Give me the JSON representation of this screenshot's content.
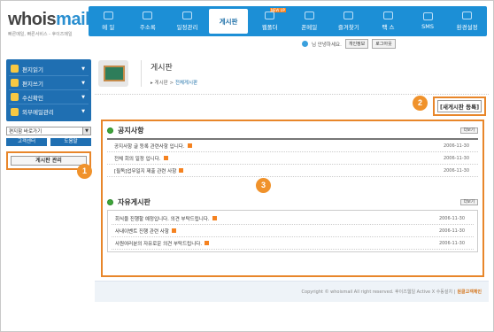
{
  "logo": {
    "brand_a": "whois",
    "brand_b": "mail",
    "tagline": "빠른메일, 빠른서비스 - 후이즈메일"
  },
  "nav": {
    "items": [
      {
        "label": "메 일",
        "icon": "mail-icon"
      },
      {
        "label": "주소록",
        "icon": "address-book-icon"
      },
      {
        "label": "일정관리",
        "icon": "calendar-icon"
      },
      {
        "label": "게시판",
        "icon": "board-icon"
      },
      {
        "label": "웹폴더",
        "icon": "folder-icon",
        "badge": "NEW UP"
      },
      {
        "label": "폰메일",
        "icon": "phone-icon"
      },
      {
        "label": "즐겨찾기",
        "icon": "bookmark-icon"
      },
      {
        "label": "팩 스",
        "icon": "fax-icon"
      },
      {
        "label": "SMS",
        "icon": "sms-icon"
      },
      {
        "label": "환경설정",
        "icon": "settings-icon"
      }
    ],
    "active_index": 3
  },
  "userbar": {
    "greeting": "님 안녕하세요.",
    "btn_profile": "개인정보",
    "btn_logout": "로그아웃"
  },
  "sidebar": {
    "items": [
      {
        "label": "편지읽기"
      },
      {
        "label": "편지쓰기"
      },
      {
        "label": "수신확인"
      },
      {
        "label": "외부메일관리"
      }
    ],
    "folder_select": "편지함 바로가기",
    "btn_support": "고객센터",
    "btn_help": "도움말",
    "btn_board_manage": "게시판 관리"
  },
  "page": {
    "title": "게시판",
    "breadcrumb_home": "게시판",
    "breadcrumb_sep": ">",
    "breadcrumb_current": "전체게시판",
    "new_board_button": "[새게시판 등록]"
  },
  "notice": {
    "title": "공지사항",
    "more": "더보기",
    "posts": [
      {
        "title": "공지사항 글 등록 관련사항 입니다.",
        "date": "2006-11-30"
      },
      {
        "title": "전체 회의 일정 입니다.",
        "date": "2006-11-30"
      },
      {
        "title": "[필독]업무일지 제출 관련 사항",
        "date": "2006-11-30"
      }
    ]
  },
  "free": {
    "title": "자유게시판",
    "more": "더보기",
    "posts": [
      {
        "title": "회식을 진행할 예정입니다. 의견 부탁드립니다.",
        "date": "2006-11-30"
      },
      {
        "title": "사내이벤트 진행 관련 사항",
        "date": "2006-11-30"
      },
      {
        "title": "사원여러분의 자유로운 의견 부탁드립니다.",
        "date": "2006-11-30"
      }
    ]
  },
  "callouts": [
    "1",
    "2",
    "3"
  ],
  "footer": {
    "text": "Copyright © whoismail All right reserved. 후이즈웹일 Active X 수동설치 |",
    "org": "원클고객체인"
  },
  "colors": {
    "nav_blue": "#1c8fd6",
    "side_blue": "#1f6fb2",
    "highlight_orange": "#e8862a",
    "callout_orange": "#f0922b"
  }
}
